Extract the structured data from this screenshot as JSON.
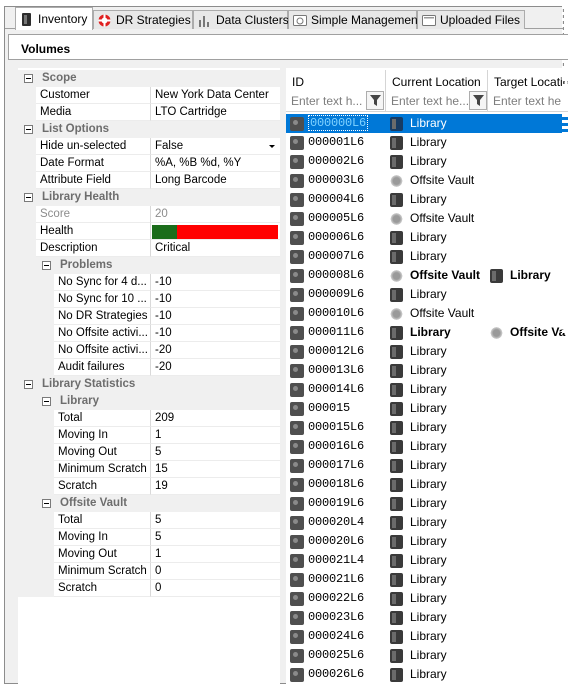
{
  "tabs": [
    {
      "label": "Inventory",
      "icon": "tape-icon",
      "active": true
    },
    {
      "label": "DR Strategies",
      "icon": "lifebuoy-icon",
      "active": false
    },
    {
      "label": "Data Clusters",
      "icon": "bar-chart-icon",
      "active": false
    },
    {
      "label": "Simple Management",
      "icon": "gauge-icon",
      "active": false
    },
    {
      "label": "Uploaded Files",
      "icon": "file-icon",
      "active": false
    }
  ],
  "panel_title": "Volumes",
  "properties": {
    "scope": {
      "label": "Scope",
      "customer_label": "Customer",
      "customer_value": "New York Data Center",
      "media_label": "Media",
      "media_value": "LTO Cartridge"
    },
    "list_options": {
      "label": "List Options",
      "hide_label": "Hide un-selected",
      "hide_value": "False",
      "date_label": "Date Format",
      "date_value": "%A, %B %d, %Y",
      "attr_label": "Attribute Field",
      "attr_value": "Long Barcode"
    },
    "library_health": {
      "label": "Library Health",
      "score_label": "Score",
      "score_value": "20",
      "health_label": "Health",
      "health_level": 0.2,
      "desc_label": "Description",
      "desc_value": "Critical"
    },
    "problems": {
      "label": "Problems",
      "items": [
        {
          "name": "No Sync for 4 d...",
          "value": "-10"
        },
        {
          "name": "No Sync for 10 ...",
          "value": "-10"
        },
        {
          "name": "No DR Strategies",
          "value": "-10"
        },
        {
          "name": "No Offsite activi...",
          "value": "-10"
        },
        {
          "name": "No Offsite activi...",
          "value": "-20"
        },
        {
          "name": "Audit failures",
          "value": "-20"
        }
      ]
    },
    "library_statistics": {
      "label": "Library Statistics",
      "library": {
        "label": "Library",
        "items": [
          {
            "name": "Total",
            "value": "209"
          },
          {
            "name": "Moving In",
            "value": "1"
          },
          {
            "name": "Moving Out",
            "value": "5"
          },
          {
            "name": "Minimum Scratch",
            "value": "15"
          },
          {
            "name": "Scratch",
            "value": "19"
          }
        ]
      },
      "offsite": {
        "label": "Offsite Vault",
        "items": [
          {
            "name": "Total",
            "value": "5"
          },
          {
            "name": "Moving In",
            "value": "5"
          },
          {
            "name": "Moving Out",
            "value": "1"
          },
          {
            "name": "Minimum Scratch",
            "value": "0"
          },
          {
            "name": "Scratch",
            "value": "0"
          }
        ]
      }
    }
  },
  "grid": {
    "columns": [
      {
        "label": "ID",
        "placeholder": "Enter text h..."
      },
      {
        "label": "Current Location",
        "placeholder": "Enter text he..."
      },
      {
        "label": "Target Locatio",
        "placeholder": "Enter text he"
      }
    ],
    "rows": [
      {
        "id": "000000L6",
        "loc": "Library",
        "target": "",
        "selected": true
      },
      {
        "id": "000001L6",
        "loc": "Library",
        "target": ""
      },
      {
        "id": "000002L6",
        "loc": "Library",
        "target": ""
      },
      {
        "id": "000003L6",
        "loc": "Offsite Vault",
        "target": ""
      },
      {
        "id": "000004L6",
        "loc": "Library",
        "target": ""
      },
      {
        "id": "000005L6",
        "loc": "Offsite Vault",
        "target": ""
      },
      {
        "id": "000006L6",
        "loc": "Library",
        "target": ""
      },
      {
        "id": "000007L6",
        "loc": "Library",
        "target": ""
      },
      {
        "id": "000008L6",
        "loc": "Offsite Vault",
        "target": "Library",
        "bold": true
      },
      {
        "id": "000009L6",
        "loc": "Library",
        "target": ""
      },
      {
        "id": "000010L6",
        "loc": "Offsite Vault",
        "target": ""
      },
      {
        "id": "000011L6",
        "loc": "Library",
        "target": "Offsite Va",
        "bold": true
      },
      {
        "id": "000012L6",
        "loc": "Library",
        "target": ""
      },
      {
        "id": "000013L6",
        "loc": "Library",
        "target": ""
      },
      {
        "id": "000014L6",
        "loc": "Library",
        "target": ""
      },
      {
        "id": "000015",
        "loc": "Library",
        "target": ""
      },
      {
        "id": "000015L6",
        "loc": "Library",
        "target": ""
      },
      {
        "id": "000016L6",
        "loc": "Library",
        "target": ""
      },
      {
        "id": "000017L6",
        "loc": "Library",
        "target": ""
      },
      {
        "id": "000018L6",
        "loc": "Library",
        "target": ""
      },
      {
        "id": "000019L6",
        "loc": "Library",
        "target": ""
      },
      {
        "id": "000020L4",
        "loc": "Library",
        "target": ""
      },
      {
        "id": "000020L6",
        "loc": "Library",
        "target": ""
      },
      {
        "id": "000021L4",
        "loc": "Library",
        "target": ""
      },
      {
        "id": "000021L6",
        "loc": "Library",
        "target": ""
      },
      {
        "id": "000022L6",
        "loc": "Library",
        "target": ""
      },
      {
        "id": "000023L6",
        "loc": "Library",
        "target": ""
      },
      {
        "id": "000024L6",
        "loc": "Library",
        "target": ""
      },
      {
        "id": "000025L6",
        "loc": "Library",
        "target": ""
      },
      {
        "id": "000026L6",
        "loc": "Library",
        "target": ""
      }
    ]
  }
}
